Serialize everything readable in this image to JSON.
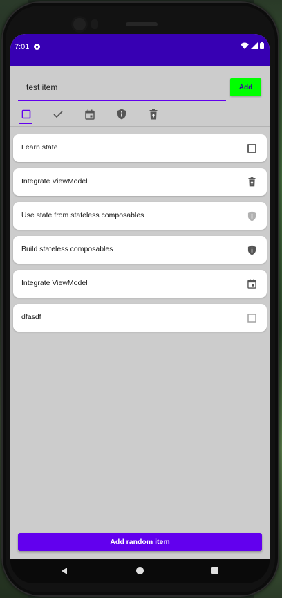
{
  "status_bar": {
    "time": "7:01"
  },
  "input": {
    "value": "test item"
  },
  "add_button": {
    "label": "Add"
  },
  "icon_row": [
    {
      "icon": "checkbox-outline-icon",
      "selected": true
    },
    {
      "icon": "checkmark-icon",
      "selected": false
    },
    {
      "icon": "calendar-icon",
      "selected": false
    },
    {
      "icon": "shield-info-icon",
      "selected": false
    },
    {
      "icon": "trash-restore-icon",
      "selected": false
    }
  ],
  "items": [
    {
      "label": "Learn state",
      "icon": "checkbox-outline-icon",
      "alpha": 1.0
    },
    {
      "label": "Integrate ViewModel",
      "icon": "trash-restore-icon",
      "alpha": 1.0
    },
    {
      "label": "Use state from stateless composables",
      "icon": "shield-info-icon",
      "alpha": 0.45
    },
    {
      "label": "Build stateless composables",
      "icon": "shield-info-icon",
      "alpha": 1.0
    },
    {
      "label": "Integrate ViewModel",
      "icon": "calendar-icon",
      "alpha": 1.0
    },
    {
      "label": "dfasdf",
      "icon": "checkbox-outline-icon",
      "alpha": 0.45
    }
  ],
  "bottom_button": {
    "label": "Add random item"
  },
  "colors": {
    "status_bar": "#3700b3",
    "primary": "#6200ee",
    "add_button": "#00ff00",
    "background": "#cccccc",
    "card": "#ffffff",
    "icon": "#555555"
  }
}
